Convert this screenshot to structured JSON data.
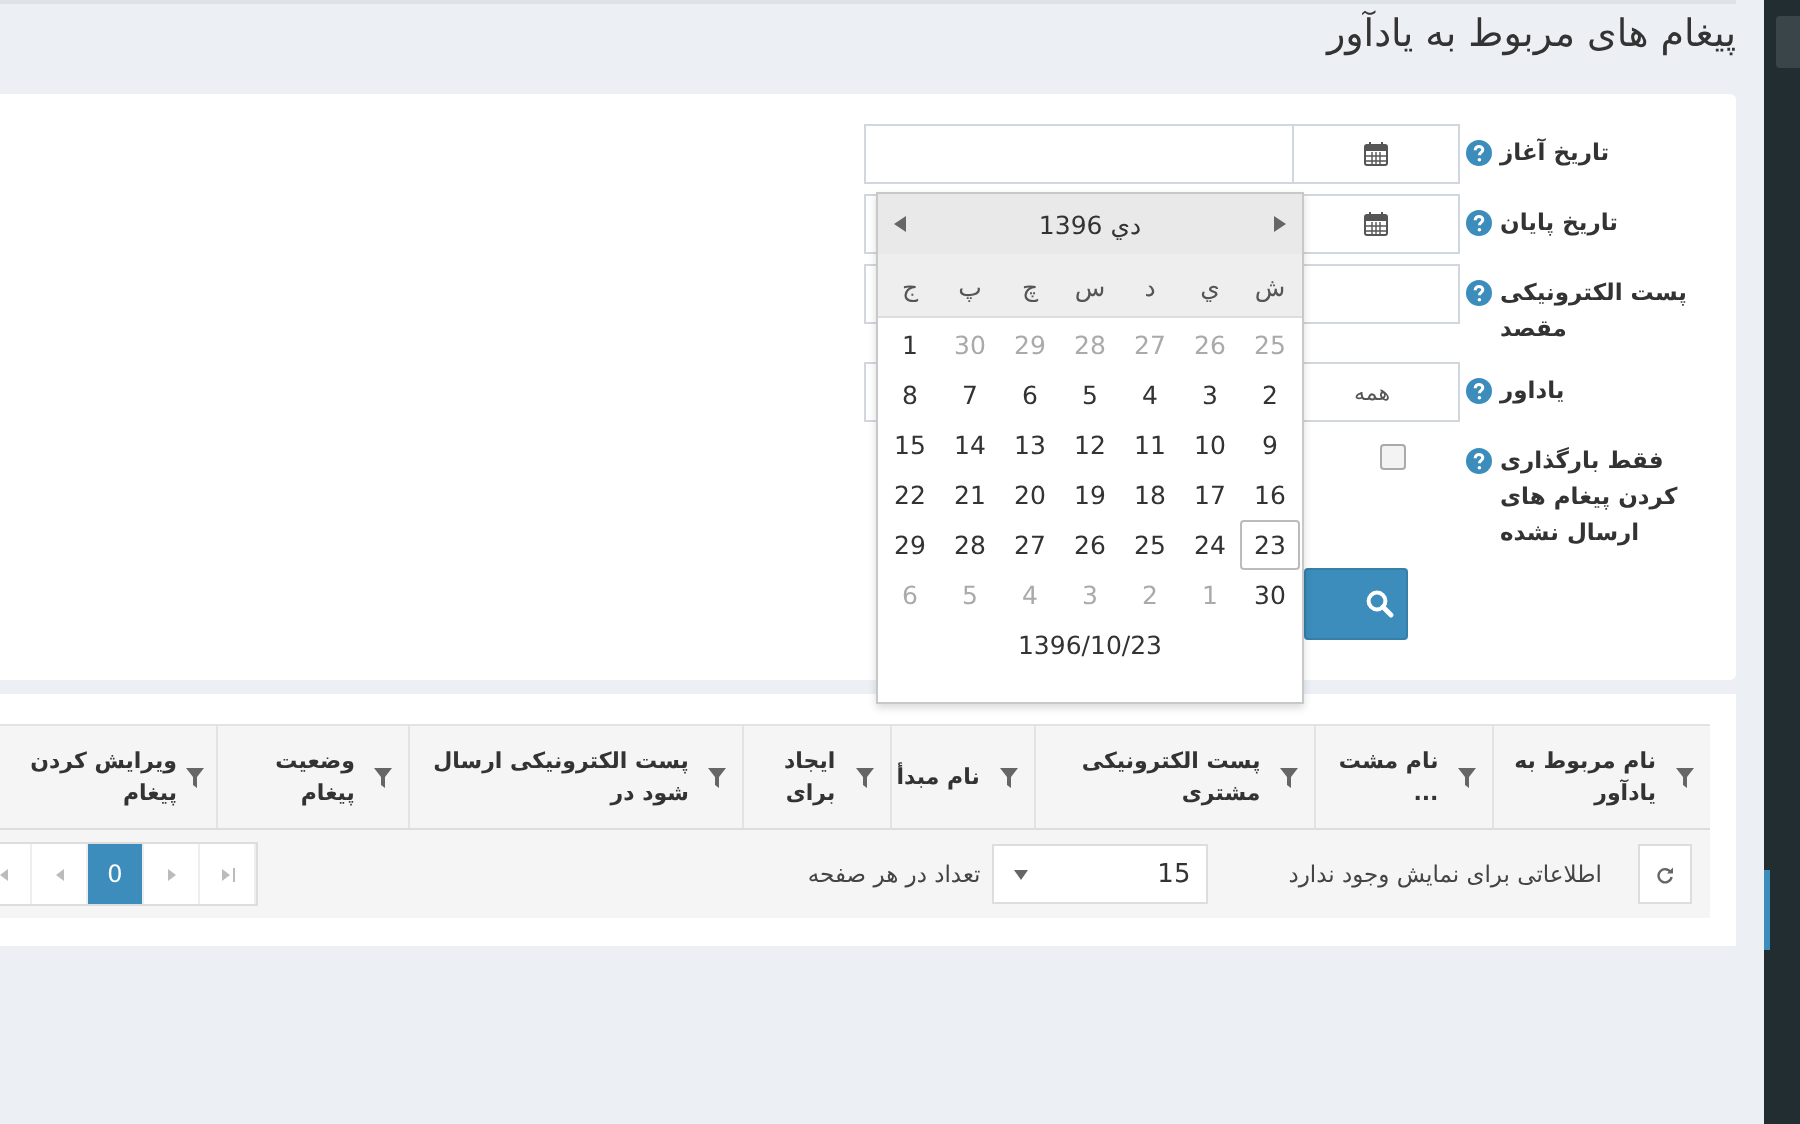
{
  "page_title": "پیغام های مربوط به یادآور",
  "filters": [
    {
      "kind": "date",
      "label": "تاریخ آغاز"
    },
    {
      "kind": "date",
      "label": "تاریخ پایان"
    },
    {
      "kind": "text",
      "label": "پست الکترونیکی مقصد"
    },
    {
      "kind": "select",
      "label": "یاداور",
      "value": "همه"
    },
    {
      "kind": "checkbox",
      "label": "فقط بارگذاری کردن پیغام های ارسال نشده",
      "checked": false
    }
  ],
  "date_picker": {
    "month": "دي 1396",
    "weekdays": [
      "ش",
      "ي",
      "د",
      "س",
      "چ",
      "پ",
      "ج"
    ],
    "weeks": [
      [
        {
          "day": "25",
          "muted": true,
          "today": false
        },
        {
          "day": "26",
          "muted": true,
          "today": false
        },
        {
          "day": "27",
          "muted": true,
          "today": false
        },
        {
          "day": "28",
          "muted": true,
          "today": false
        },
        {
          "day": "29",
          "muted": true,
          "today": false
        },
        {
          "day": "30",
          "muted": true,
          "today": false
        },
        {
          "day": "1",
          "muted": false,
          "today": false
        }
      ],
      [
        {
          "day": "2",
          "muted": false,
          "today": false
        },
        {
          "day": "3",
          "muted": false,
          "today": false
        },
        {
          "day": "4",
          "muted": false,
          "today": false
        },
        {
          "day": "5",
          "muted": false,
          "today": false
        },
        {
          "day": "6",
          "muted": false,
          "today": false
        },
        {
          "day": "7",
          "muted": false,
          "today": false
        },
        {
          "day": "8",
          "muted": false,
          "today": false
        }
      ],
      [
        {
          "day": "9",
          "muted": false,
          "today": false
        },
        {
          "day": "10",
          "muted": false,
          "today": false
        },
        {
          "day": "11",
          "muted": false,
          "today": false
        },
        {
          "day": "12",
          "muted": false,
          "today": false
        },
        {
          "day": "13",
          "muted": false,
          "today": false
        },
        {
          "day": "14",
          "muted": false,
          "today": false
        },
        {
          "day": "15",
          "muted": false,
          "today": false
        }
      ],
      [
        {
          "day": "16",
          "muted": false,
          "today": false
        },
        {
          "day": "17",
          "muted": false,
          "today": false
        },
        {
          "day": "18",
          "muted": false,
          "today": false
        },
        {
          "day": "19",
          "muted": false,
          "today": false
        },
        {
          "day": "20",
          "muted": false,
          "today": false
        },
        {
          "day": "21",
          "muted": false,
          "today": false
        },
        {
          "day": "22",
          "muted": false,
          "today": false
        }
      ],
      [
        {
          "day": "23",
          "muted": false,
          "today": true
        },
        {
          "day": "24",
          "muted": false,
          "today": false
        },
        {
          "day": "25",
          "muted": false,
          "today": false
        },
        {
          "day": "26",
          "muted": false,
          "today": false
        },
        {
          "day": "27",
          "muted": false,
          "today": false
        },
        {
          "day": "28",
          "muted": false,
          "today": false
        },
        {
          "day": "29",
          "muted": false,
          "today": false
        }
      ],
      [
        {
          "day": "30",
          "muted": false,
          "today": false
        },
        {
          "day": "1",
          "muted": true,
          "today": false
        },
        {
          "day": "2",
          "muted": true,
          "today": false
        },
        {
          "day": "3",
          "muted": true,
          "today": false
        },
        {
          "day": "4",
          "muted": true,
          "today": false
        },
        {
          "day": "5",
          "muted": true,
          "today": false
        },
        {
          "day": "6",
          "muted": true,
          "today": false
        }
      ]
    ],
    "footer": "1396/10/23"
  },
  "table": {
    "columns": [
      "نام مربوط به یادآور",
      "نام مشت ...",
      "پست الکترونیکی مشتری",
      "نام مبدأ",
      "ایجاد برای",
      "پست الکترونیکی ارسال شود در",
      "وضعیت پیغام",
      "ویرایش کردن پیغام"
    ],
    "empty_message": "اطلاعاتی برای نمایش وجود ندارد",
    "page_size": "15",
    "page_size_label": "تعداد در هر صفحه",
    "pages": [
      {
        "label": "0",
        "selected": true
      }
    ]
  }
}
